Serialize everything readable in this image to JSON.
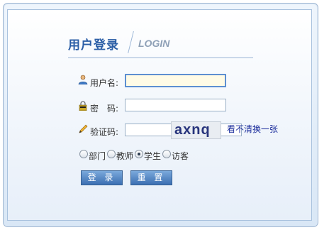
{
  "header": {
    "title_zh": "用户登录",
    "title_en": "LOGIN"
  },
  "form": {
    "username": {
      "label": "用户名:",
      "value": ""
    },
    "password": {
      "label": "密　码:",
      "value": ""
    },
    "captcha": {
      "label": "验证码:",
      "value": "",
      "image_text": "axnq",
      "refresh_text": "看不清换一张"
    },
    "roles": [
      {
        "label": "部门",
        "checked": false
      },
      {
        "label": "教师",
        "checked": false
      },
      {
        "label": "学生",
        "checked": true
      },
      {
        "label": "访客",
        "checked": false
      }
    ],
    "buttons": {
      "login": "登 录",
      "reset": "重 置"
    }
  },
  "icons": {
    "username": "user-icon",
    "password": "lock-icon",
    "captcha": "pencil-icon"
  }
}
